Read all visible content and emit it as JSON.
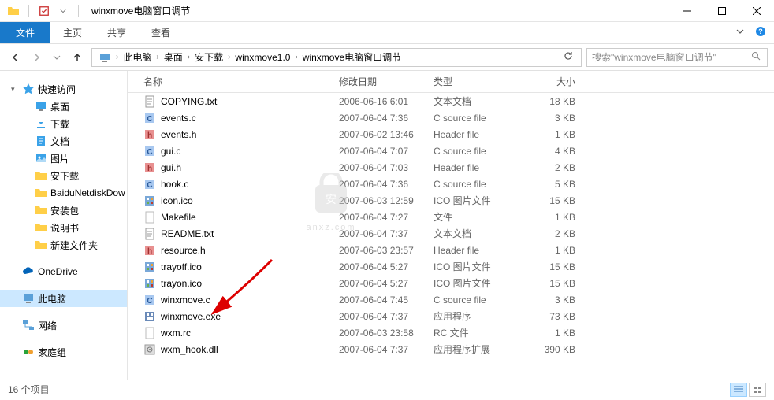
{
  "window": {
    "title": "winxmove电脑窗口调节"
  },
  "ribbon": {
    "file": "文件",
    "tabs": [
      "主页",
      "共享",
      "查看"
    ]
  },
  "breadcrumb": {
    "segments": [
      "此电脑",
      "桌面",
      "安下载",
      "winxmove1.0",
      "winxmove电脑窗口调节"
    ]
  },
  "search": {
    "placeholder": "搜索\"winxmove电脑窗口调节\""
  },
  "sidebar": {
    "quick": {
      "label": "快速访问",
      "items": [
        {
          "label": "桌面",
          "icon": "desktop"
        },
        {
          "label": "下载",
          "icon": "download"
        },
        {
          "label": "文档",
          "icon": "document"
        },
        {
          "label": "图片",
          "icon": "picture"
        },
        {
          "label": "安下载",
          "icon": "folder"
        },
        {
          "label": "BaiduNetdiskDow",
          "icon": "folder"
        },
        {
          "label": "安装包",
          "icon": "folder"
        },
        {
          "label": "说明书",
          "icon": "folder"
        },
        {
          "label": "新建文件夹",
          "icon": "folder"
        }
      ]
    },
    "onedrive": {
      "label": "OneDrive"
    },
    "thispc": {
      "label": "此电脑"
    },
    "network": {
      "label": "网络"
    },
    "homegroup": {
      "label": "家庭组"
    }
  },
  "columns": {
    "name": "名称",
    "date": "修改日期",
    "type": "类型",
    "size": "大小"
  },
  "files": [
    {
      "name": "COPYING.txt",
      "date": "2006-06-16 6:01",
      "type": "文本文档",
      "size": "18 KB",
      "icon": "txt"
    },
    {
      "name": "events.c",
      "date": "2007-06-04 7:36",
      "type": "C source file",
      "size": "3 KB",
      "icon": "c"
    },
    {
      "name": "events.h",
      "date": "2007-06-02 13:46",
      "type": "Header file",
      "size": "1 KB",
      "icon": "h"
    },
    {
      "name": "gui.c",
      "date": "2007-06-04 7:07",
      "type": "C source file",
      "size": "4 KB",
      "icon": "c"
    },
    {
      "name": "gui.h",
      "date": "2007-06-04 7:03",
      "type": "Header file",
      "size": "2 KB",
      "icon": "h"
    },
    {
      "name": "hook.c",
      "date": "2007-06-04 7:36",
      "type": "C source file",
      "size": "5 KB",
      "icon": "c"
    },
    {
      "name": "icon.ico",
      "date": "2007-06-03 12:59",
      "type": "ICO 图片文件",
      "size": "15 KB",
      "icon": "ico"
    },
    {
      "name": "Makefile",
      "date": "2007-06-04 7:27",
      "type": "文件",
      "size": "1 KB",
      "icon": "blank"
    },
    {
      "name": "README.txt",
      "date": "2007-06-04 7:37",
      "type": "文本文档",
      "size": "2 KB",
      "icon": "txt"
    },
    {
      "name": "resource.h",
      "date": "2007-06-03 23:57",
      "type": "Header file",
      "size": "1 KB",
      "icon": "h"
    },
    {
      "name": "trayoff.ico",
      "date": "2007-06-04 5:27",
      "type": "ICO 图片文件",
      "size": "15 KB",
      "icon": "ico"
    },
    {
      "name": "trayon.ico",
      "date": "2007-06-04 5:27",
      "type": "ICO 图片文件",
      "size": "15 KB",
      "icon": "ico"
    },
    {
      "name": "winxmove.c",
      "date": "2007-06-04 7:45",
      "type": "C source file",
      "size": "3 KB",
      "icon": "c"
    },
    {
      "name": "winxmove.exe",
      "date": "2007-06-04 7:37",
      "type": "应用程序",
      "size": "73 KB",
      "icon": "exe"
    },
    {
      "name": "wxm.rc",
      "date": "2007-06-03 23:58",
      "type": "RC 文件",
      "size": "1 KB",
      "icon": "blank"
    },
    {
      "name": "wxm_hook.dll",
      "date": "2007-06-04 7:37",
      "type": "应用程序扩展",
      "size": "390 KB",
      "icon": "dll"
    }
  ],
  "status": {
    "count": "16 个项目"
  }
}
